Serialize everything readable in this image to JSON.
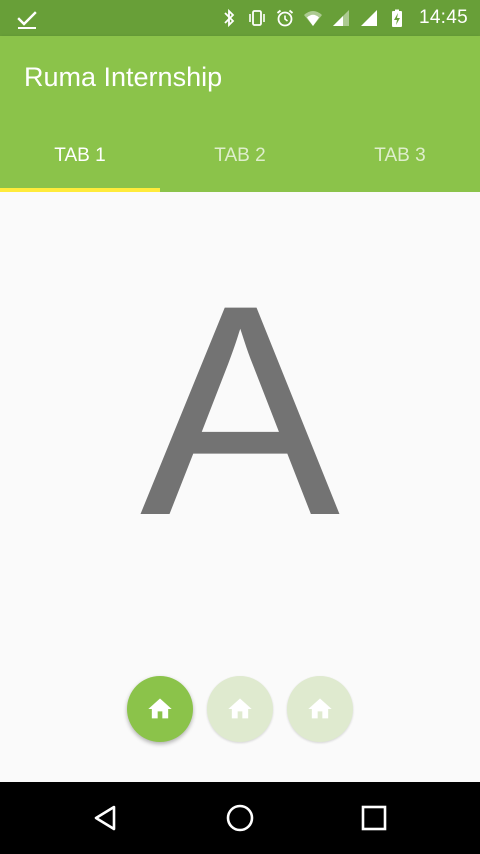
{
  "status_bar": {
    "time": "14:45",
    "icons": [
      "check-icon",
      "bluetooth-icon",
      "vibrate-icon",
      "alarm-icon",
      "wifi-icon",
      "signal-icon",
      "signal-icon",
      "battery-charging-icon"
    ]
  },
  "app_bar": {
    "title": "Ruma Internship"
  },
  "tabs": [
    {
      "label": "TAB 1",
      "active": true
    },
    {
      "label": "TAB 2",
      "active": false
    },
    {
      "label": "TAB 3",
      "active": false
    }
  ],
  "content": {
    "letter": "A"
  },
  "page_indicator": {
    "count": 3,
    "active_index": 0,
    "icon": "home-icon"
  },
  "navigation": {
    "back_icon": "back-icon",
    "home_icon": "home-circle-icon",
    "recents_icon": "recents-icon"
  },
  "colors": {
    "status_bar": "#689f38",
    "primary": "#8bc34a",
    "tab_indicator": "#ffeb3b",
    "letter": "#737373",
    "inactive_dot": "#dfeacf",
    "background": "#fafafa",
    "nav_bar": "#000000"
  }
}
